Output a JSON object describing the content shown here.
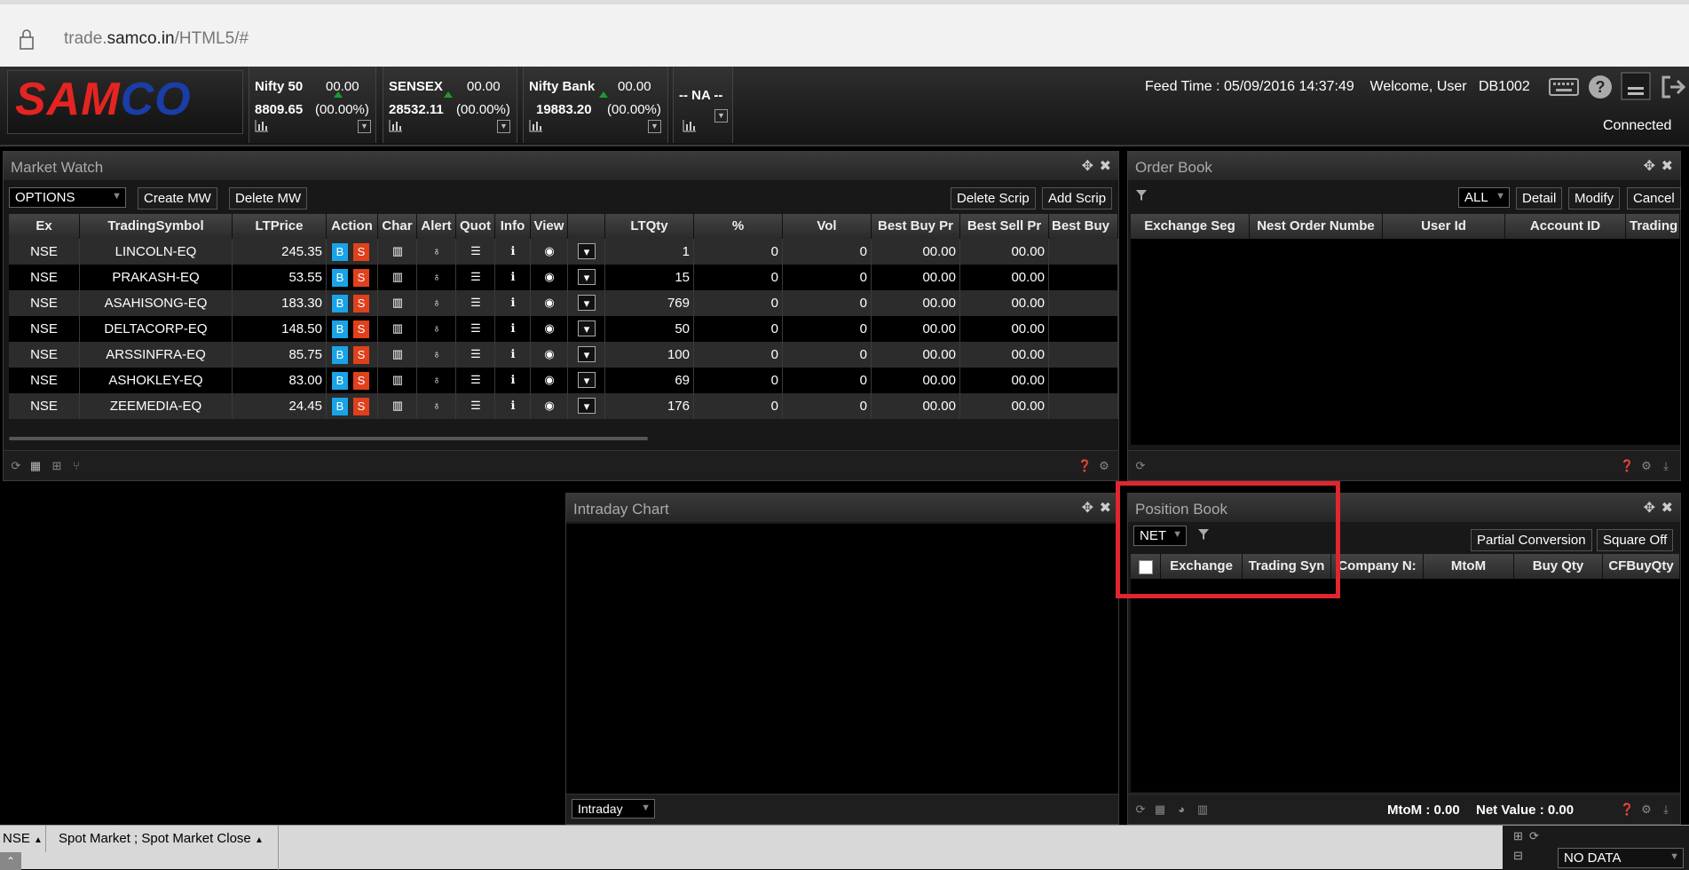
{
  "browser": {
    "url_prefix": "trade.",
    "url_domain": "samco.in",
    "url_path": "/HTML5/#"
  },
  "logo": {
    "text_red": "SAM",
    "text_blue": "CO"
  },
  "indices": [
    {
      "name": "Nifty 50",
      "change": "00.00",
      "value": "8809.65",
      "pct": "(00.00%)"
    },
    {
      "name": "SENSEX",
      "change": "00.00",
      "value": "28532.11",
      "pct": "(00.00%)"
    },
    {
      "name": "Nifty Bank",
      "change": "00.00",
      "value": "19883.20",
      "pct": "(00.00%)"
    },
    {
      "name": "-- NA --"
    }
  ],
  "header": {
    "feed_label": "Feed Time :",
    "feed_time": "05/09/2016 14:37:49",
    "welcome": "Welcome, User",
    "user_id": "DB1002",
    "status": "Connected"
  },
  "market_watch": {
    "title": "Market Watch",
    "list_select": "OPTIONS",
    "buttons": {
      "create": "Create MW",
      "delete": "Delete MW",
      "delete_scrip": "Delete Scrip",
      "add_scrip": "Add Scrip"
    },
    "columns": [
      "Ex",
      "TradingSymbol",
      "LTPrice",
      "Action",
      "Char",
      "Alert",
      "Quot",
      "Info",
      "View",
      "",
      "LTQty",
      "%",
      "Vol",
      "Best Buy Pr",
      "Best Sell Pr",
      "Best Buy"
    ],
    "buy_label": "B",
    "sell_label": "S",
    "rows": [
      {
        "ex": "NSE",
        "symbol": "LINCOLN-EQ",
        "ltp": "245.35",
        "ltq": "1",
        "pct": "0",
        "vol": "0",
        "bbp": "00.00",
        "bsp": "00.00"
      },
      {
        "ex": "NSE",
        "symbol": "PRAKASH-EQ",
        "ltp": "53.55",
        "ltq": "15",
        "pct": "0",
        "vol": "0",
        "bbp": "00.00",
        "bsp": "00.00"
      },
      {
        "ex": "NSE",
        "symbol": "ASAHISONG-EQ",
        "ltp": "183.30",
        "ltq": "769",
        "pct": "0",
        "vol": "0",
        "bbp": "00.00",
        "bsp": "00.00"
      },
      {
        "ex": "NSE",
        "symbol": "DELTACORP-EQ",
        "ltp": "148.50",
        "ltq": "50",
        "pct": "0",
        "vol": "0",
        "bbp": "00.00",
        "bsp": "00.00"
      },
      {
        "ex": "NSE",
        "symbol": "ARSSINFRA-EQ",
        "ltp": "85.75",
        "ltq": "100",
        "pct": "0",
        "vol": "0",
        "bbp": "00.00",
        "bsp": "00.00"
      },
      {
        "ex": "NSE",
        "symbol": "ASHOKLEY-EQ",
        "ltp": "83.00",
        "ltq": "69",
        "pct": "0",
        "vol": "0",
        "bbp": "00.00",
        "bsp": "00.00"
      },
      {
        "ex": "NSE",
        "symbol": "ZEEMEDIA-EQ",
        "ltp": "24.45",
        "ltq": "176",
        "pct": "0",
        "vol": "0",
        "bbp": "00.00",
        "bsp": "00.00"
      }
    ]
  },
  "order_book": {
    "title": "Order Book",
    "filter_select": "ALL",
    "buttons": {
      "detail": "Detail",
      "modify": "Modify",
      "cancel": "Cancel"
    },
    "columns": [
      "Exchange Seg",
      "Nest Order Numbe",
      "User Id",
      "Account ID",
      "Trading"
    ]
  },
  "intraday_chart": {
    "title": "Intraday Chart",
    "period_select": "Intraday"
  },
  "position_book": {
    "title": "Position Book",
    "type_select": "NET",
    "buttons": {
      "partial": "Partial Conversion",
      "square_off": "Square Off"
    },
    "columns": [
      "Exchange",
      "Trading Syn",
      "Company N:",
      "MtoM",
      "Buy Qty",
      "CFBuyQty"
    ],
    "mtom": "MtoM : 0.00",
    "net_value": "Net Value : 0.00"
  },
  "status_bar": {
    "exchange": "NSE",
    "market": "Spot Market ; Spot Market Close",
    "data_select": "NO DATA"
  },
  "colors": {
    "buy": "#1aa3e6",
    "sell": "#e0401c",
    "highlight": "#e0262e"
  }
}
